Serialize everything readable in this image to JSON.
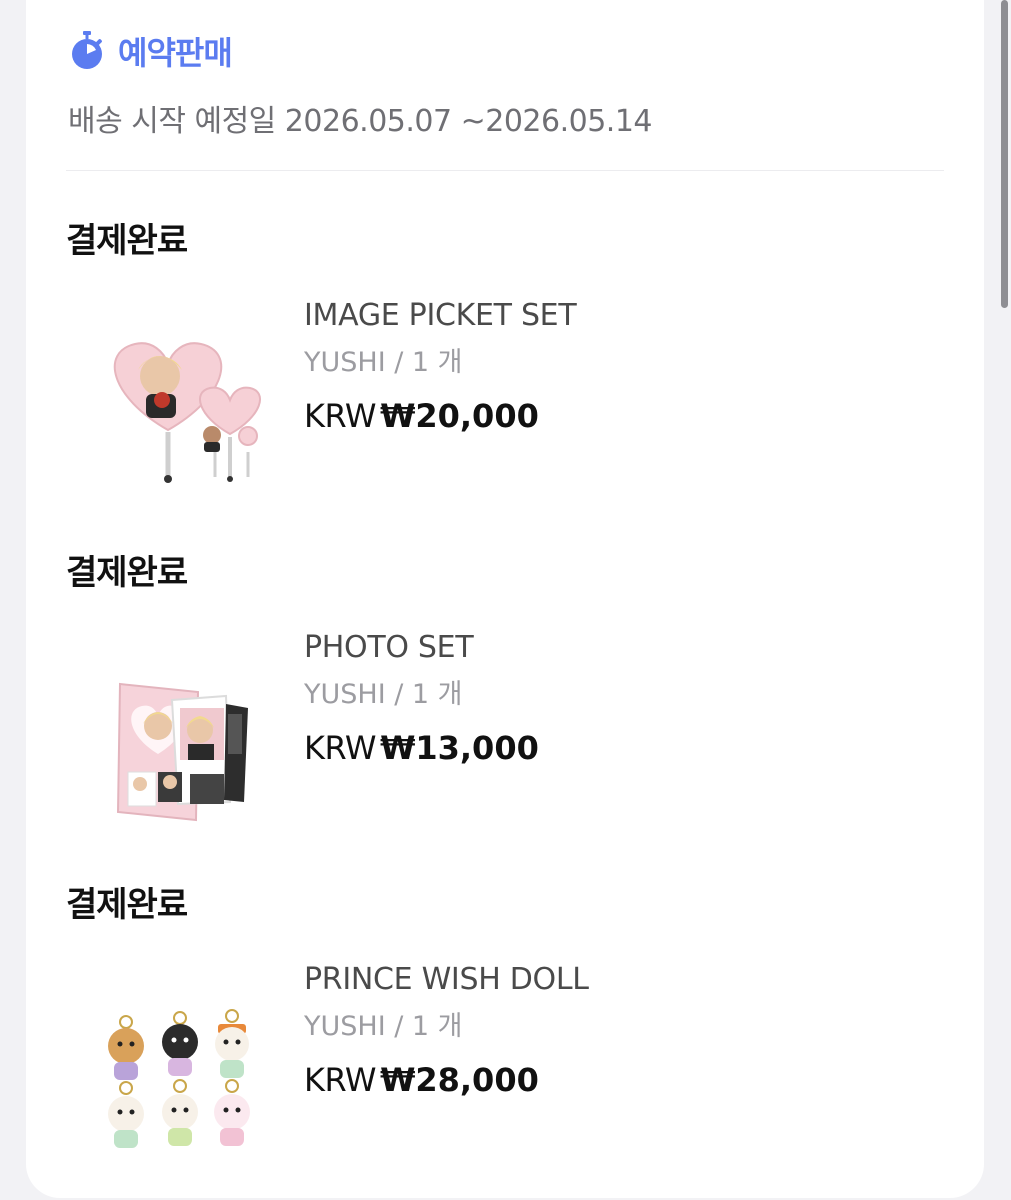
{
  "presale": {
    "label": "예약판매",
    "icon": "stopwatch-icon"
  },
  "shipping": {
    "text": "배송 시작 예정일 2026.05.07 ~2026.05.14"
  },
  "orders": [
    {
      "status": "결제완료",
      "name": "IMAGE PICKET SET",
      "option": "YUSHI / 1 개",
      "currency": "KRW",
      "amount": "₩20,000"
    },
    {
      "status": "결제완료",
      "name": "PHOTO SET",
      "option": "YUSHI / 1 개",
      "currency": "KRW",
      "amount": "₩13,000"
    },
    {
      "status": "결제완료",
      "name": "PRINCE WISH DOLL",
      "option": "YUSHI / 1 개",
      "currency": "KRW",
      "amount": "₩28,000"
    }
  ],
  "colors": {
    "accent": "#5b7cf0",
    "text": "#111111",
    "muted": "#9c9ca1"
  }
}
